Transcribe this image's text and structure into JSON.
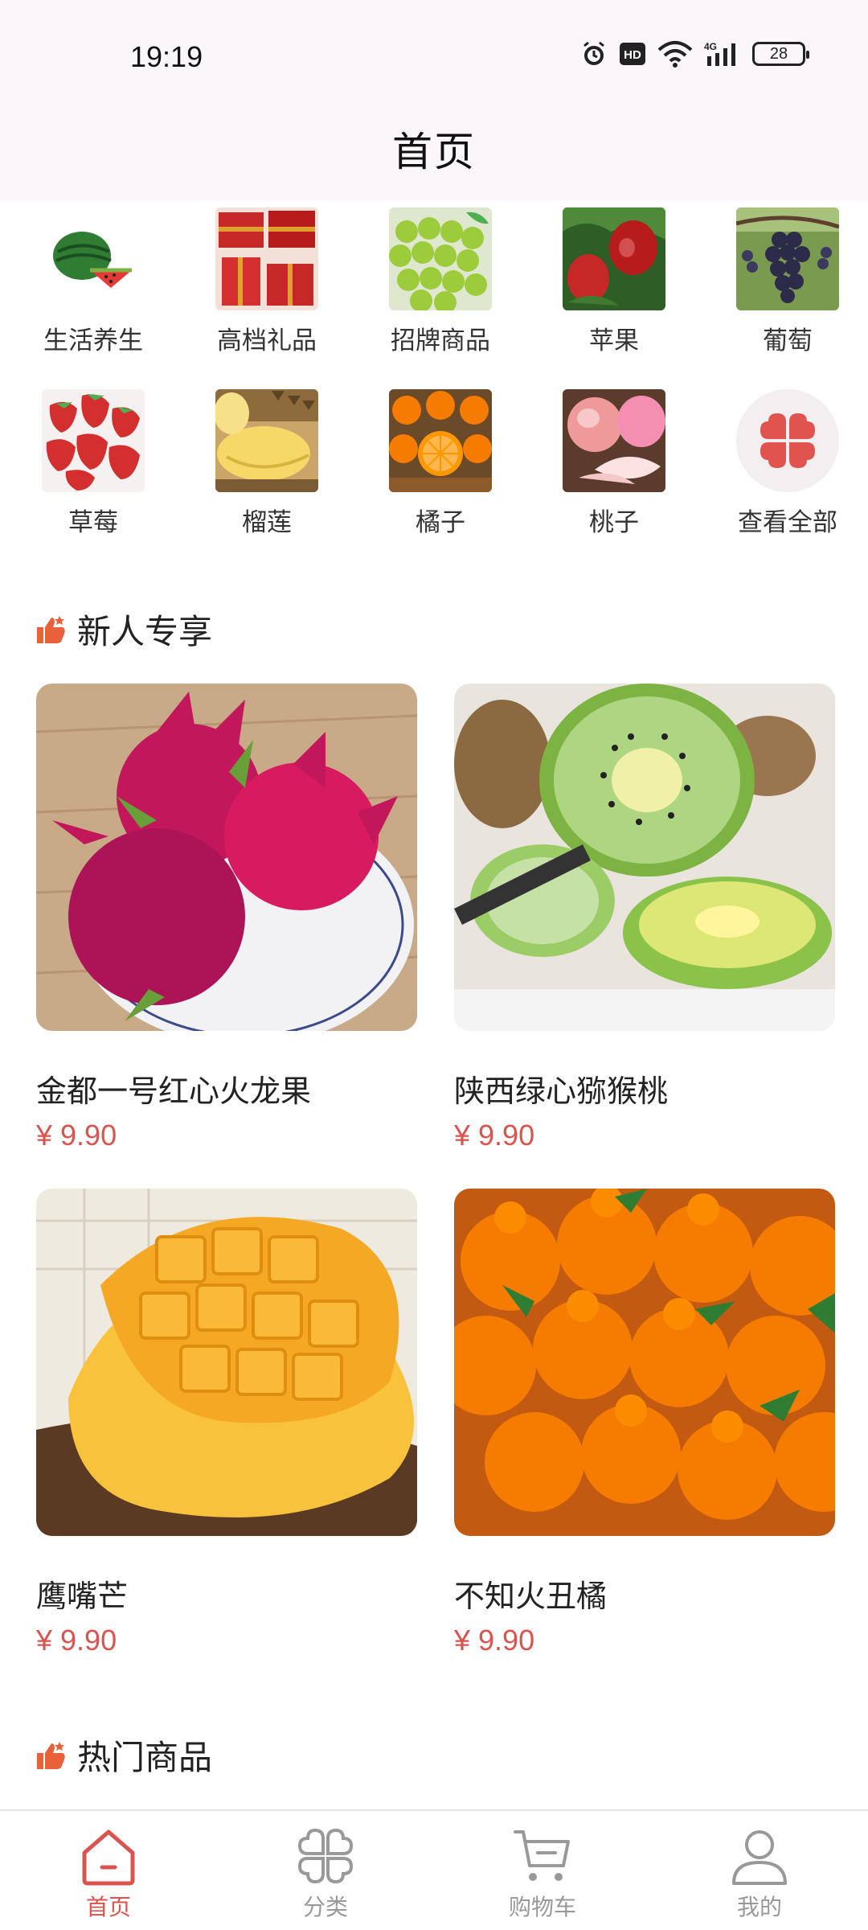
{
  "status_bar": {
    "time": "19:19",
    "network": "4G",
    "battery": "28"
  },
  "header": {
    "title": "首页"
  },
  "categories": [
    {
      "label": "生活养生",
      "icon": "watermelon-image"
    },
    {
      "label": "高档礼品",
      "icon": "gift-box-image"
    },
    {
      "label": "招牌商品",
      "icon": "green-grapes-image"
    },
    {
      "label": "苹果",
      "icon": "apple-image"
    },
    {
      "label": "葡萄",
      "icon": "grape-image"
    },
    {
      "label": "草莓",
      "icon": "strawberry-image"
    },
    {
      "label": "榴莲",
      "icon": "durian-image"
    },
    {
      "label": "橘子",
      "icon": "orange-image"
    },
    {
      "label": "桃子",
      "icon": "peach-image"
    },
    {
      "label": "查看全部",
      "icon": "view-all-icon"
    }
  ],
  "sections": {
    "newcomer": {
      "title": "新人专享"
    },
    "hot": {
      "title": "热门商品"
    }
  },
  "products": [
    {
      "name": "金都一号红心火龙果",
      "price": "¥ 9.90",
      "image": "dragon-fruit-image"
    },
    {
      "name": "陕西绿心猕猴桃",
      "price": "¥ 9.90",
      "image": "kiwi-image"
    },
    {
      "name": "鹰嘴芒",
      "price": "¥ 9.90",
      "image": "mango-image"
    },
    {
      "name": "不知火丑橘",
      "price": "¥ 9.90",
      "image": "dekopon-image"
    }
  ],
  "bottom_nav": [
    {
      "label": "首页",
      "icon": "home-icon",
      "active": true
    },
    {
      "label": "分类",
      "icon": "category-icon",
      "active": false
    },
    {
      "label": "购物车",
      "icon": "cart-icon",
      "active": false
    },
    {
      "label": "我的",
      "icon": "profile-icon",
      "active": false
    }
  ],
  "colors": {
    "accent": "#d9534f",
    "header_bg": "#fbf6fa",
    "section_icon": "#e8613a"
  }
}
